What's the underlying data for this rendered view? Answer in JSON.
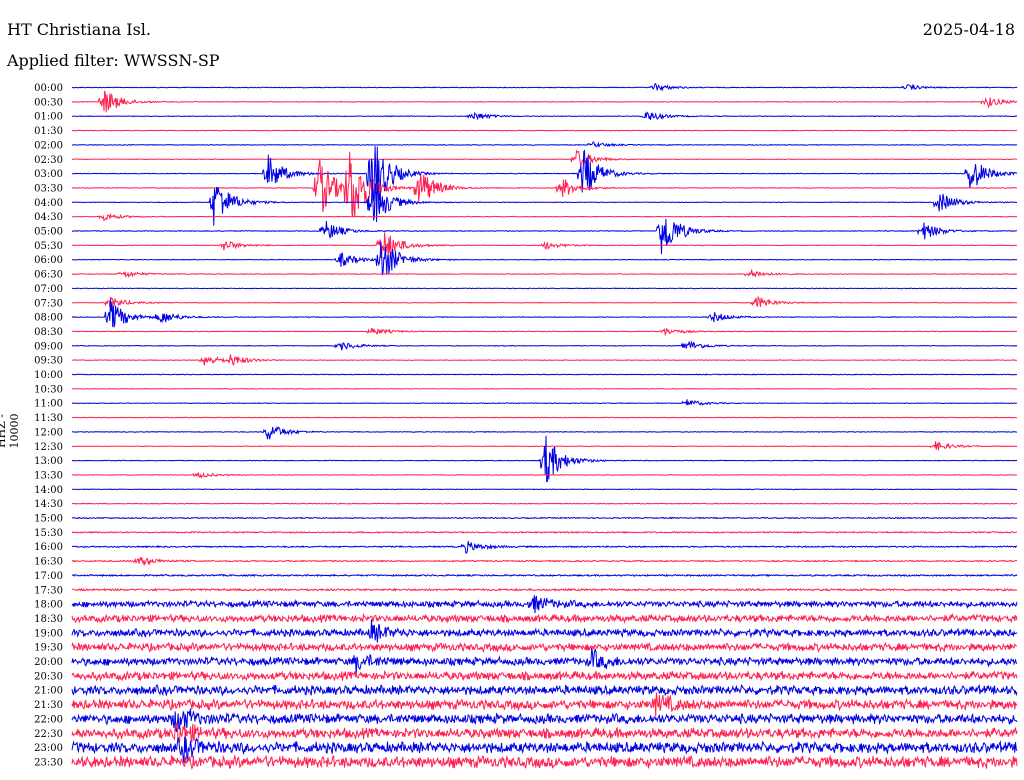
{
  "header": {
    "station": "HT Christiana Isl.",
    "date": "2025-04-18",
    "filter": "Applied filter: WWSSN-SP"
  },
  "chart_data": {
    "type": "line",
    "ylabel": "HHZ - 10000",
    "tick_labels": [
      "00:00",
      "00:30",
      "01:00",
      "01:30",
      "02:00",
      "02:30",
      "03:00",
      "03:30",
      "04:00",
      "04:30",
      "05:00",
      "05:30",
      "06:00",
      "06:30",
      "07:00",
      "07:30",
      "08:00",
      "08:30",
      "09:00",
      "09:30",
      "10:00",
      "10:30",
      "11:00",
      "11:30",
      "12:00",
      "12:30",
      "13:00",
      "13:30",
      "14:00",
      "14:30",
      "15:00",
      "15:30",
      "16:00",
      "16:30",
      "17:00",
      "17:30",
      "18:00",
      "18:30",
      "19:00",
      "19:30",
      "20:00",
      "20:30",
      "21:00",
      "21:30",
      "22:00",
      "22:30",
      "23:00",
      "23:30"
    ],
    "colors": [
      "#0000e6",
      "#ff2050"
    ],
    "noise_level": [
      0.3,
      0.3,
      0.3,
      0.3,
      0.3,
      0.3,
      0.3,
      0.3,
      0.3,
      0.3,
      0.3,
      0.3,
      0.3,
      0.3,
      0.3,
      0.3,
      0.3,
      0.3,
      0.3,
      0.3,
      0.3,
      0.3,
      0.3,
      0.3,
      0.3,
      0.3,
      0.3,
      0.3,
      0.3,
      0.35,
      0.5,
      0.6,
      0.6,
      0.6,
      0.7,
      0.9,
      2.5,
      3,
      3,
      3.2,
      3.2,
      3.5,
      3.8,
      4,
      4,
      4.2,
      4.5,
      4.8
    ],
    "events": [
      {
        "trace": 0,
        "minute": 18.5,
        "amp": 4
      },
      {
        "trace": 0,
        "minute": 26.5,
        "amp": 3
      },
      {
        "trace": 1,
        "minute": 1,
        "amp": 14
      },
      {
        "trace": 1,
        "minute": 29,
        "amp": 6
      },
      {
        "trace": 2,
        "minute": 12.7,
        "amp": 5
      },
      {
        "trace": 2,
        "minute": 18.2,
        "amp": 6
      },
      {
        "trace": 4,
        "minute": 16.5,
        "amp": 3
      },
      {
        "trace": 5,
        "minute": 16,
        "amp": 10
      },
      {
        "trace": 6,
        "minute": 9.5,
        "amp": 48
      },
      {
        "trace": 6,
        "minute": 6.2,
        "amp": 20
      },
      {
        "trace": 6,
        "minute": 16.2,
        "amp": 28
      },
      {
        "trace": 6,
        "minute": 28.5,
        "amp": 20
      },
      {
        "trace": 7,
        "minute": 8.8,
        "amp": 45
      },
      {
        "trace": 7,
        "minute": 7.8,
        "amp": 35
      },
      {
        "trace": 7,
        "minute": 11,
        "amp": 22
      },
      {
        "trace": 7,
        "minute": 15.5,
        "amp": 12
      },
      {
        "trace": 8,
        "minute": 4.5,
        "amp": 28
      },
      {
        "trace": 8,
        "minute": 9.5,
        "amp": 30
      },
      {
        "trace": 8,
        "minute": 27.5,
        "amp": 12
      },
      {
        "trace": 9,
        "minute": 1,
        "amp": 4
      },
      {
        "trace": 10,
        "minute": 8,
        "amp": 12
      },
      {
        "trace": 10,
        "minute": 18.7,
        "amp": 30
      },
      {
        "trace": 10,
        "minute": 27,
        "amp": 10
      },
      {
        "trace": 11,
        "minute": 4.8,
        "amp": 6
      },
      {
        "trace": 11,
        "minute": 9.8,
        "amp": 20
      },
      {
        "trace": 11,
        "minute": 15,
        "amp": 4
      },
      {
        "trace": 12,
        "minute": 9.8,
        "amp": 25
      },
      {
        "trace": 12,
        "minute": 8.5,
        "amp": 8
      },
      {
        "trace": 13,
        "minute": 1.6,
        "amp": 4
      },
      {
        "trace": 13,
        "minute": 21.5,
        "amp": 5
      },
      {
        "trace": 15,
        "minute": 1.2,
        "amp": 6
      },
      {
        "trace": 15,
        "minute": 21.7,
        "amp": 7
      },
      {
        "trace": 16,
        "minute": 1.2,
        "amp": 18
      },
      {
        "trace": 16,
        "minute": 2.8,
        "amp": 7
      },
      {
        "trace": 16,
        "minute": 20.3,
        "amp": 6
      },
      {
        "trace": 17,
        "minute": 18.8,
        "amp": 4
      },
      {
        "trace": 17,
        "minute": 9.5,
        "amp": 4
      },
      {
        "trace": 18,
        "minute": 19.5,
        "amp": 6
      },
      {
        "trace": 18,
        "minute": 8.5,
        "amp": 5
      },
      {
        "trace": 19,
        "minute": 4.2,
        "amp": 6
      },
      {
        "trace": 19,
        "minute": 5,
        "amp": 6
      },
      {
        "trace": 22,
        "minute": 19.5,
        "amp": 4
      },
      {
        "trace": 24,
        "minute": 6.2,
        "amp": 10
      },
      {
        "trace": 25,
        "minute": 27.4,
        "amp": 5
      },
      {
        "trace": 26,
        "minute": 15,
        "amp": 28
      },
      {
        "trace": 27,
        "minute": 4,
        "amp": 3
      },
      {
        "trace": 32,
        "minute": 12.5,
        "amp": 6
      },
      {
        "trace": 33,
        "minute": 2.1,
        "amp": 5
      },
      {
        "trace": 36,
        "minute": 14.6,
        "amp": 8
      },
      {
        "trace": 38,
        "minute": 9.5,
        "amp": 8
      },
      {
        "trace": 40,
        "minute": 9,
        "amp": 8
      },
      {
        "trace": 40,
        "minute": 16.5,
        "amp": 8
      },
      {
        "trace": 43,
        "minute": 18.5,
        "amp": 9
      },
      {
        "trace": 44,
        "minute": 3.3,
        "amp": 13
      },
      {
        "trace": 45,
        "minute": 3.3,
        "amp": 12
      },
      {
        "trace": 46,
        "minute": 3.5,
        "amp": 10
      }
    ]
  }
}
